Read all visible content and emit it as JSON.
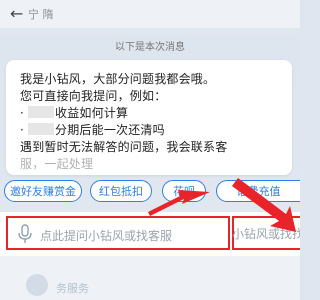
{
  "header": {
    "back_icon": "back-arrow-icon",
    "faint_label": "宁   隋"
  },
  "divider": {
    "label": "以下是本次消息"
  },
  "message": {
    "line1": "我是小钻风，大部分问题我都会哦。",
    "line2": "您可直接向我提问，例如：",
    "line3_suffix": "收益如何计算",
    "line4_suffix": "分期后能一次还清吗",
    "line5": "遇到暂时无法解答的问题，我会联系客",
    "line6": "服，一起处理"
  },
  "quick_replies": [
    {
      "label": "邀好友赚赏金"
    },
    {
      "label": "红包抵扣"
    },
    {
      "label": "花呗"
    },
    {
      "label": "话费充值"
    }
  ],
  "input": {
    "placeholder": "点此提问小钻风或找客服",
    "ghost_text": "小钻风或找找找客服",
    "mic_icon": "microphone-icon"
  },
  "bottom": {
    "faint_label": "务服务"
  },
  "colors": {
    "accent": "#2f7fe6",
    "highlight": "#e8232a"
  }
}
